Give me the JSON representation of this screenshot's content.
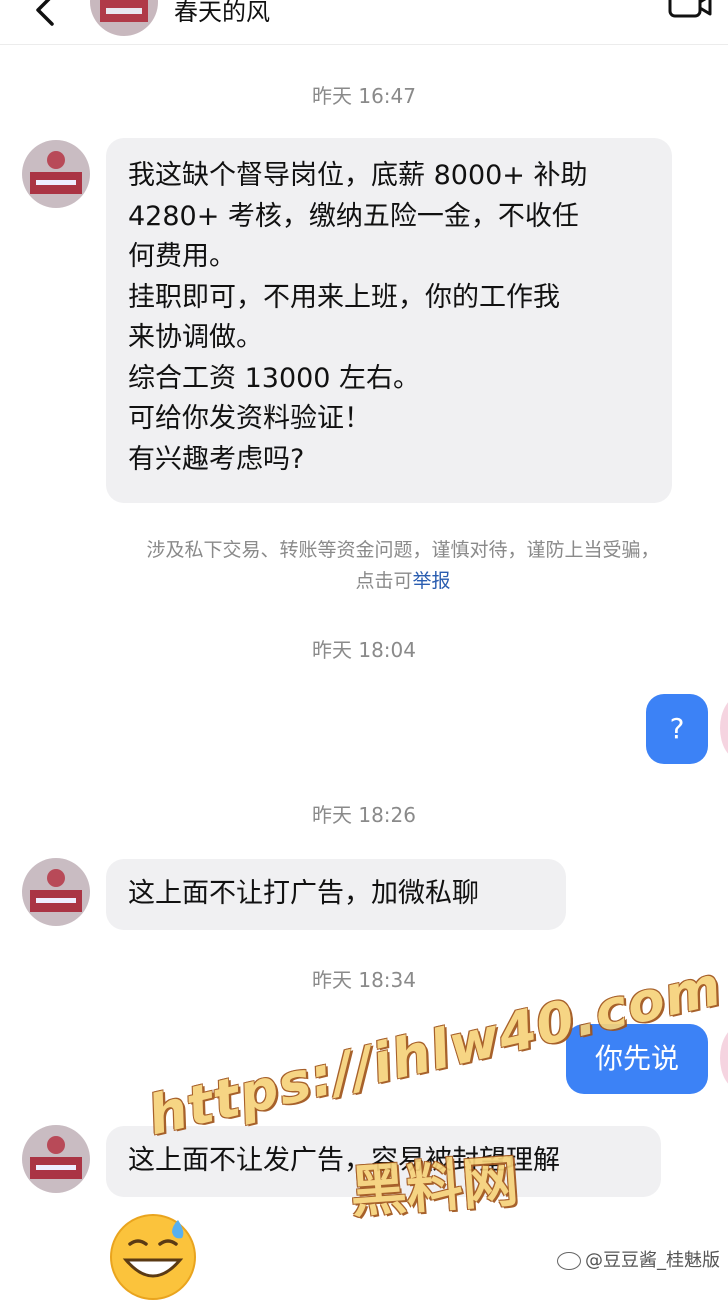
{
  "header": {
    "title": "春天的风",
    "back_icon": "chevron-left-icon",
    "call_icon": "video-call-icon"
  },
  "messages": [
    {
      "type": "timestamp",
      "text": "昨天 16:47"
    },
    {
      "type": "incoming",
      "text": "我这缺个督导岗位，底薪 8000+ 补助\n4280+ 考核，缴纳五险一金，不收任\n何费用。\n挂职即可，不用来上班，你的工作我\n来协调做。\n综合工资 13000 左右。\n可给你发资料验证！\n有兴趣考虑吗?"
    },
    {
      "type": "notice",
      "line1": "涉及私下交易、转账等资金问题，谨慎对待，谨防上当受骗，",
      "line2_prefix": "点击可",
      "link": "举报"
    },
    {
      "type": "timestamp",
      "text": "昨天 18:04"
    },
    {
      "type": "outgoing",
      "text": "?"
    },
    {
      "type": "timestamp",
      "text": "昨天 18:26"
    },
    {
      "type": "incoming",
      "text": "这上面不让打广告，加微私聊"
    },
    {
      "type": "timestamp",
      "text": "昨天 18:34"
    },
    {
      "type": "outgoing",
      "text": "你先说"
    },
    {
      "type": "incoming",
      "text": "这上面不让发广告，容易被封望理解"
    },
    {
      "type": "emoji",
      "icon": "grinning-sweat-emoji"
    }
  ],
  "watermarks": {
    "url": "https://ihlw40.com",
    "name": "黑料网",
    "weibo": "@豆豆酱_桂魅版"
  },
  "colors": {
    "outgoing_bubble": "#3c82f6",
    "incoming_bubble": "#f0f0f2",
    "link": "#2a5db0",
    "timestamp": "#8a8a8a"
  }
}
